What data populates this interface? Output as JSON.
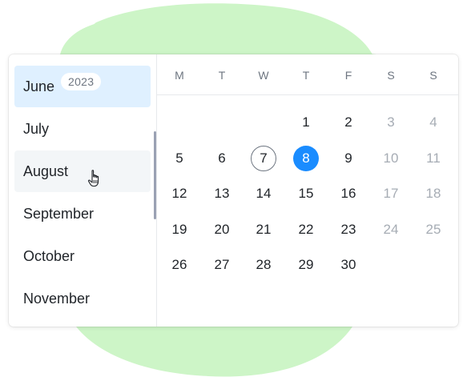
{
  "months": [
    {
      "label": "June",
      "state": "selected"
    },
    {
      "label": "July",
      "state": ""
    },
    {
      "label": "August",
      "state": "hovered"
    },
    {
      "label": "September",
      "state": ""
    },
    {
      "label": "October",
      "state": ""
    },
    {
      "label": "November",
      "state": ""
    }
  ],
  "year_badge": "2023",
  "weekdays": [
    "M",
    "T",
    "W",
    "T",
    "F",
    "S",
    "S"
  ],
  "weeks": [
    [
      null,
      null,
      null,
      "1",
      "2",
      "3",
      "4"
    ],
    [
      "5",
      "6",
      "7",
      "8",
      "9",
      "10",
      "11"
    ],
    [
      "12",
      "13",
      "14",
      "15",
      "16",
      "17",
      "18"
    ],
    [
      "19",
      "20",
      "21",
      "22",
      "23",
      "24",
      "25"
    ],
    [
      "26",
      "27",
      "28",
      "29",
      "30",
      null,
      null
    ]
  ],
  "today": "7",
  "selected_day": "8",
  "colors": {
    "accent": "#1a8cff",
    "selected_month_bg": "#dff0ff",
    "blob": "#cdf5c7",
    "muted_text": "#a6acb4"
  },
  "icons": {
    "cursor": "hand-pointer-icon"
  }
}
